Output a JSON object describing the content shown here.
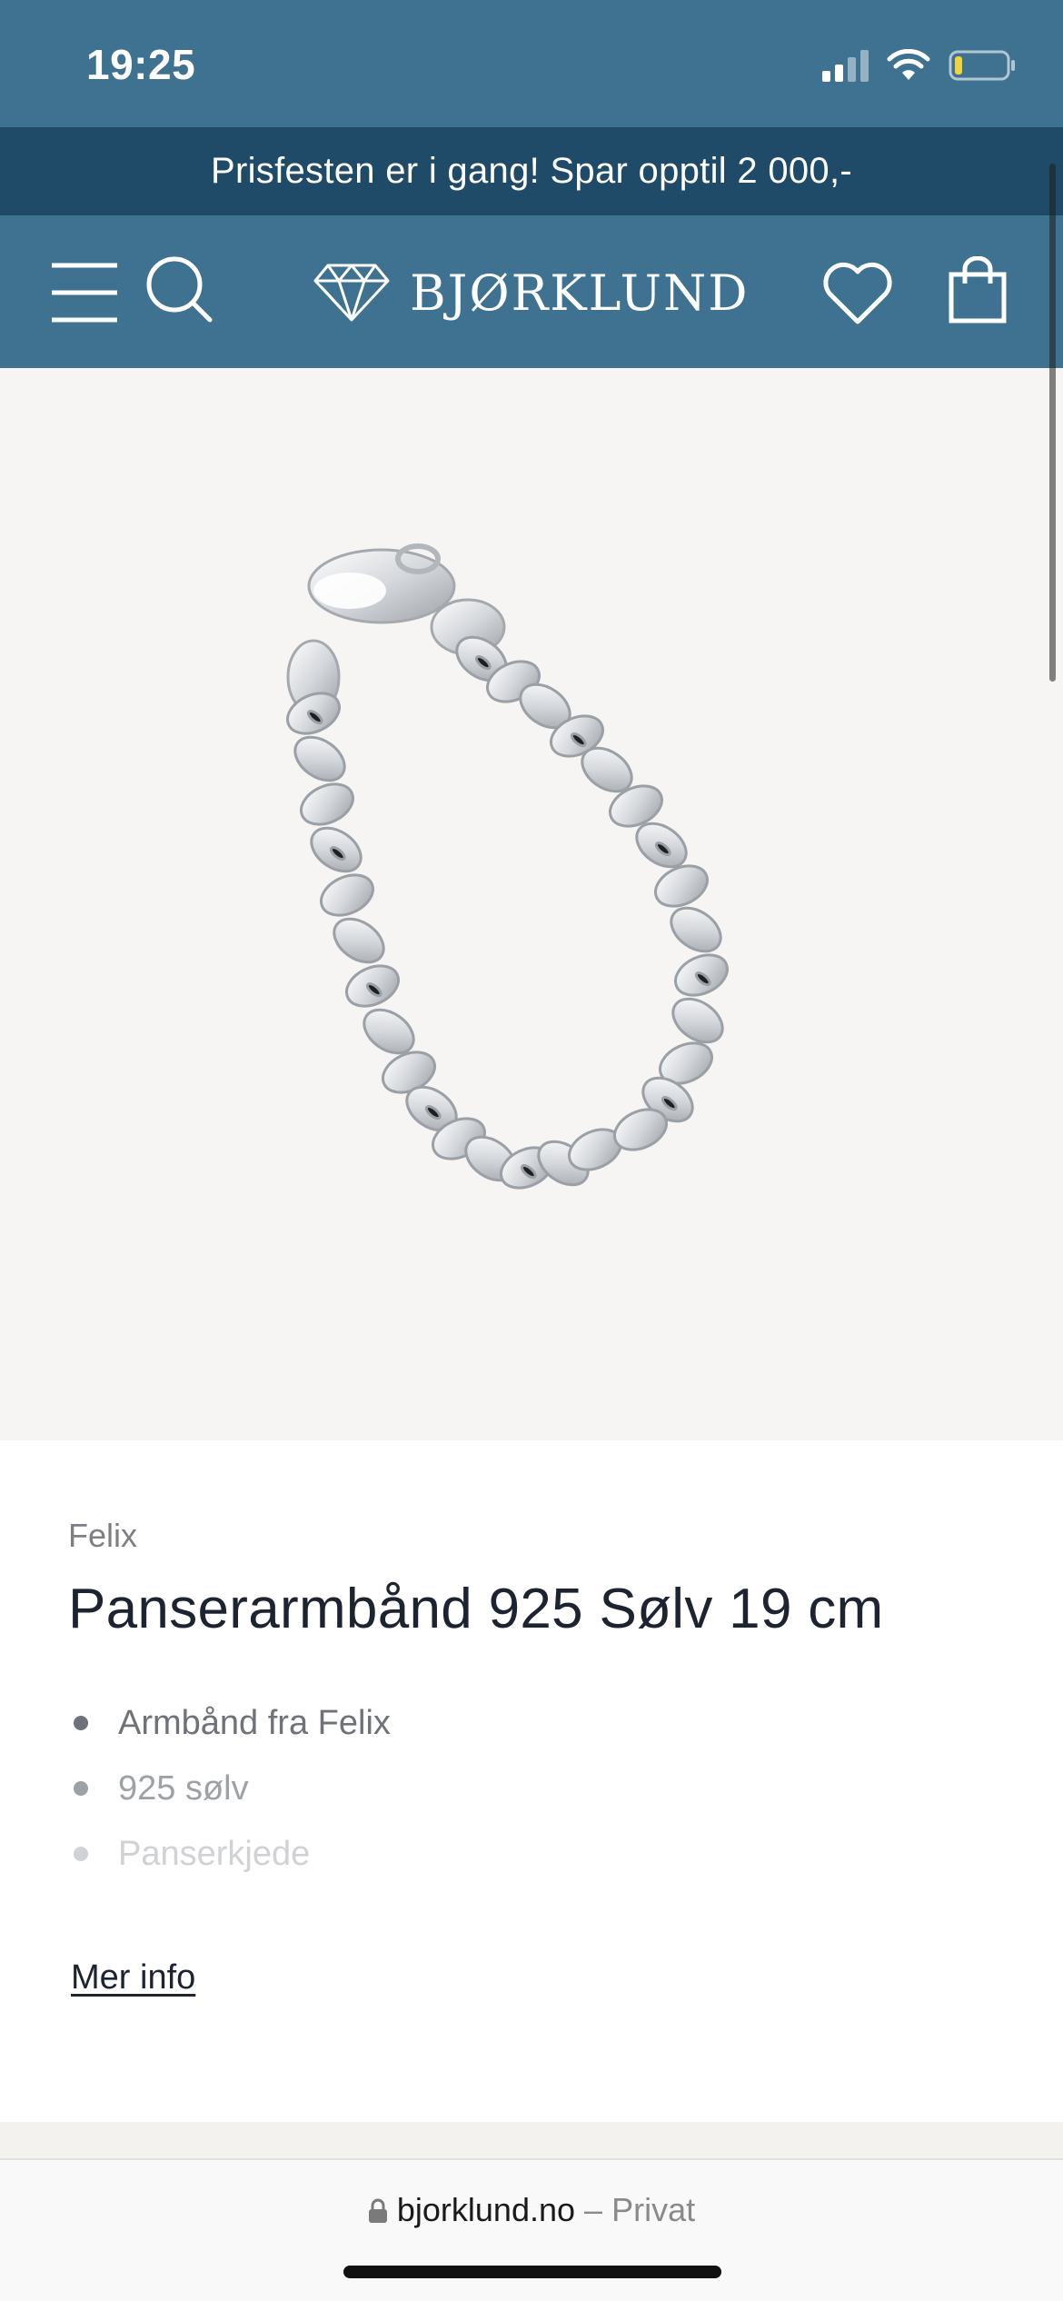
{
  "status_bar": {
    "time": "19:25",
    "icons": [
      "cellular-signal-icon",
      "wifi-icon",
      "battery-icon"
    ],
    "battery_color": "#f2d33c"
  },
  "promo_banner": {
    "text": "Prisfesten er i gang! Spar opptil 2 000,-"
  },
  "header": {
    "brand": "BJØRKLUND",
    "icons": [
      "menu-icon",
      "search-icon",
      "diamond-logo-icon",
      "heart-icon",
      "shopping-bag-icon"
    ]
  },
  "product": {
    "brand": "Felix",
    "title": "Panserarmbånd 925 Sølv 19 cm",
    "features": [
      "Armbånd fra Felix",
      "925 sølv",
      "Panserkjede"
    ],
    "more_info": "Mer info"
  },
  "address_bar": {
    "domain": "bjorklund.no",
    "separator": "–",
    "mode": "Privat"
  },
  "colors": {
    "header": "#3e7290",
    "promo": "#1f4a68",
    "image_bg": "#f6f5f4"
  }
}
